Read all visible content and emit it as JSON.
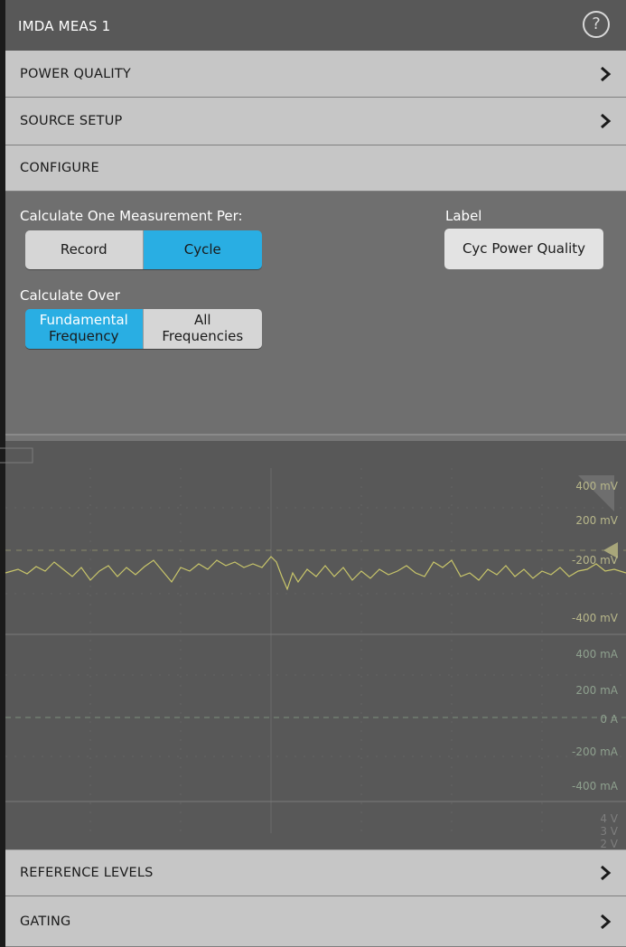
{
  "window": {
    "title": "IMDA MEAS 1",
    "help_glyph": "?"
  },
  "sections": {
    "power_quality": "POWER QUALITY",
    "source_setup": "SOURCE SETUP",
    "configure": "CONFIGURE",
    "reference_levels": "REFERENCE LEVELS",
    "gating": "GATING"
  },
  "configure": {
    "calc_per_label": "Calculate One Measurement Per:",
    "calc_per_options": [
      "Record",
      "Cycle"
    ],
    "calc_per_selected": "Cycle",
    "label_heading": "Label",
    "label_value": "Cyc Power Quality",
    "calc_over_label": "Calculate Over",
    "calc_over_options": [
      [
        "Fundamental",
        "Frequency"
      ],
      [
        "All",
        "Frequencies"
      ]
    ],
    "calc_over_selected": "Fundamental Frequency"
  },
  "background_scale_labels": {
    "voltage_mv": [
      "400 mV",
      "200 mV",
      "-200 mV",
      "-400 mV"
    ],
    "current_ma": [
      "400 mA",
      "200 mA",
      "0 A",
      "-200 mA",
      "-400 mA"
    ],
    "voltage_v": [
      "4 V",
      "3 V",
      "2 V"
    ]
  },
  "colors": {
    "accent_selected": "#29aee3",
    "waveform": "#c9c66a",
    "header_bg": "#585858",
    "section_bg": "#c6c6c6"
  }
}
